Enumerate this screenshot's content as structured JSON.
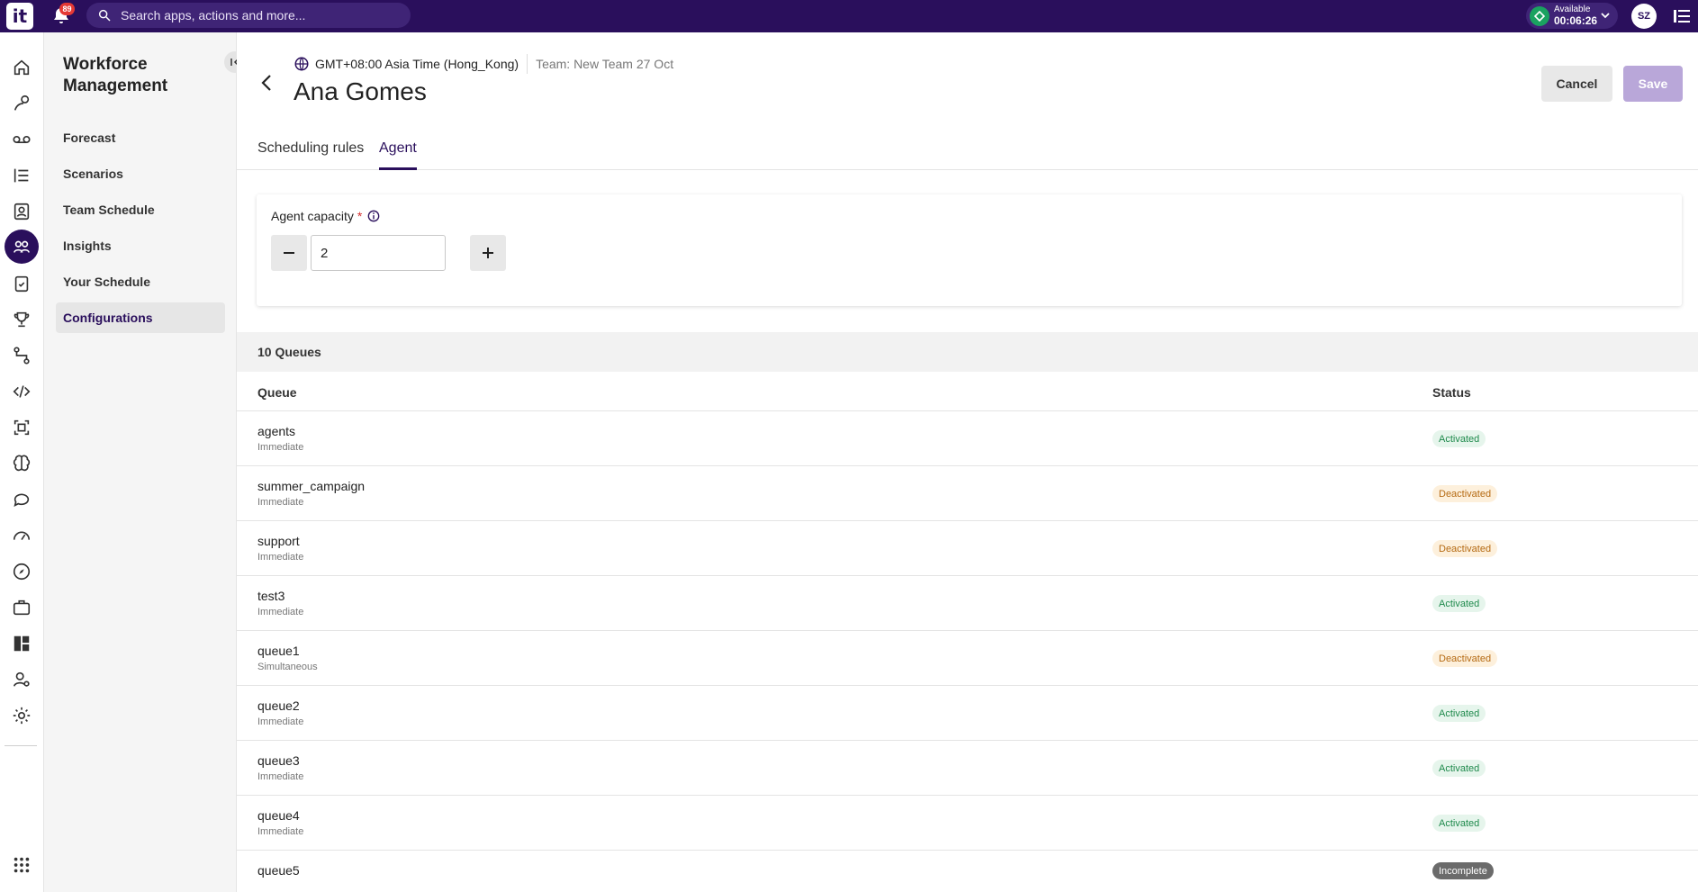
{
  "topbar": {
    "logo_text": "it",
    "notification_count": "89",
    "search_placeholder": "Search apps, actions and more...",
    "status_label": "Available",
    "status_timer": "00:06:26",
    "user_initials": "SZ",
    "accent_color": "#2a0f5c"
  },
  "subnav": {
    "title": "Workforce Management",
    "items": [
      {
        "label": "Forecast"
      },
      {
        "label": "Scenarios"
      },
      {
        "label": "Team Schedule"
      },
      {
        "label": "Insights"
      },
      {
        "label": "Your Schedule"
      },
      {
        "label": "Configurations",
        "active": true
      }
    ]
  },
  "rail_icons": [
    "home-icon",
    "journey-icon",
    "voicemail-icon",
    "list-icon",
    "contacts-icon",
    "workforce-icon",
    "clipboard-icon",
    "trophy-icon",
    "flow-icon",
    "code-icon",
    "scan-icon",
    "brain-icon",
    "chat-icon",
    "gauge-icon",
    "compass-icon",
    "briefcase-icon",
    "dashboard-icon",
    "user-settings-icon",
    "gear-icon",
    "apps-grid-icon"
  ],
  "header": {
    "timezone": "GMT+08:00 Asia Time (Hong_Kong)",
    "team": "Team: New Team 27 Oct",
    "title": "Ana Gomes",
    "cancel_label": "Cancel",
    "save_label": "Save"
  },
  "tabs": [
    {
      "label": "Scheduling rules"
    },
    {
      "label": "Agent",
      "active": true
    }
  ],
  "capacity": {
    "label": "Agent capacity",
    "required_mark": "*",
    "value": "2"
  },
  "queues": {
    "count_label": "10 Queues",
    "columns": {
      "queue": "Queue",
      "status": "Status"
    },
    "rows": [
      {
        "name": "agents",
        "mode": "Immediate",
        "status": "Activated"
      },
      {
        "name": "summer_campaign",
        "mode": "Immediate",
        "status": "Deactivated"
      },
      {
        "name": "support",
        "mode": "Immediate",
        "status": "Deactivated"
      },
      {
        "name": "test3",
        "mode": "Immediate",
        "status": "Activated"
      },
      {
        "name": "queue1",
        "mode": "Simultaneous",
        "status": "Deactivated"
      },
      {
        "name": "queue2",
        "mode": "Immediate",
        "status": "Activated"
      },
      {
        "name": "queue3",
        "mode": "Immediate",
        "status": "Activated"
      },
      {
        "name": "queue4",
        "mode": "Immediate",
        "status": "Activated"
      },
      {
        "name": "queue5",
        "mode": "",
        "status": "Incomplete"
      }
    ]
  }
}
